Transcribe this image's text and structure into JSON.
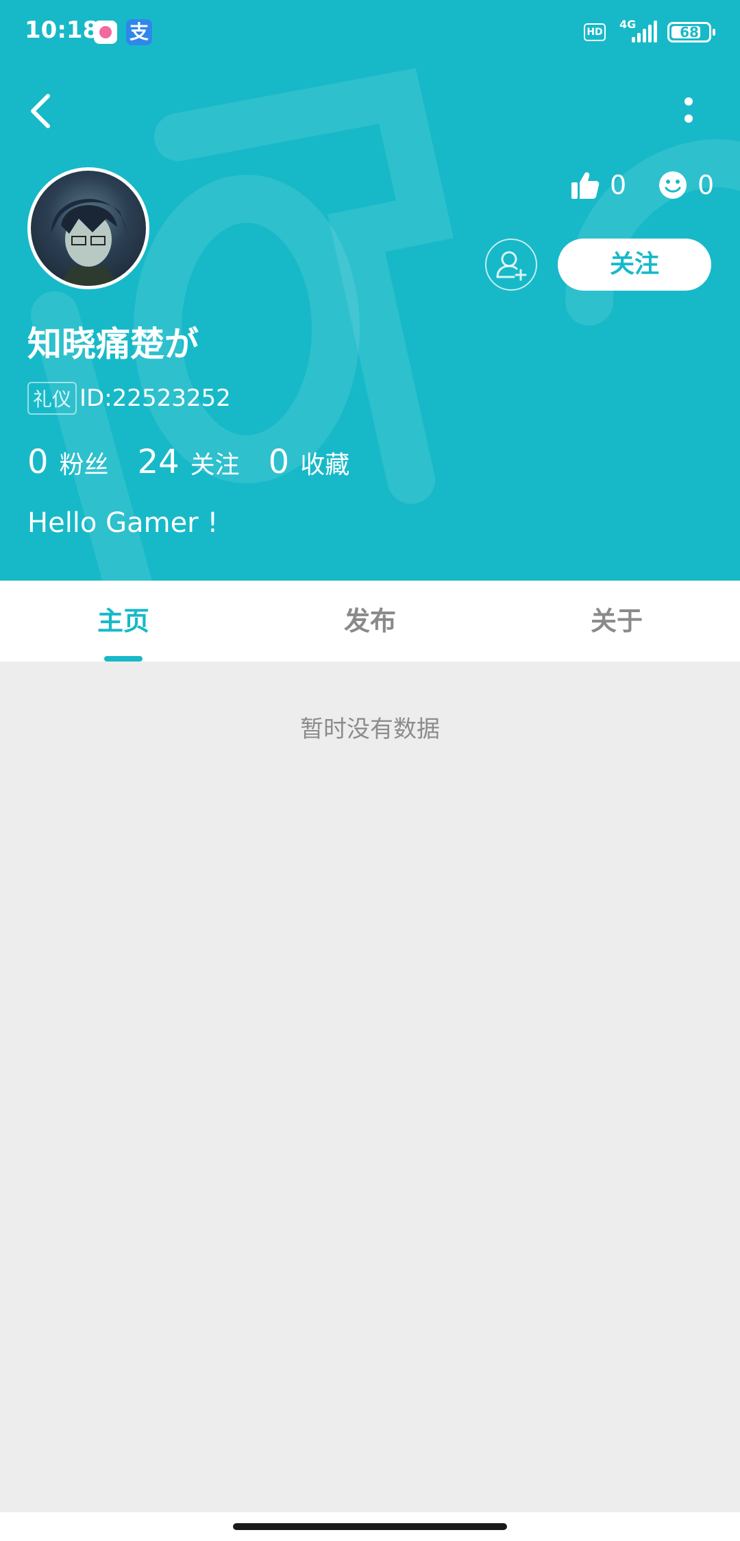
{
  "status_bar": {
    "time": "10:18",
    "hd": "HD",
    "network": "4G",
    "battery": "68"
  },
  "profile": {
    "likes": "0",
    "smiles": "0",
    "follow_label": "关注",
    "username": "知晓痛楚が",
    "badge": "礼仪",
    "user_id": "ID:22523252",
    "stats": [
      {
        "num": "0",
        "label": "粉丝"
      },
      {
        "num": "24",
        "label": "关注"
      },
      {
        "num": "0",
        "label": "收藏"
      }
    ],
    "bio": "Hello Gamer !"
  },
  "tabs": [
    {
      "label": "主页",
      "active": true
    },
    {
      "label": "发布",
      "active": false
    },
    {
      "label": "关于",
      "active": false
    }
  ],
  "empty_message": "暂时没有数据",
  "colors": {
    "accent": "#17b9c8",
    "background": "#ededed"
  }
}
